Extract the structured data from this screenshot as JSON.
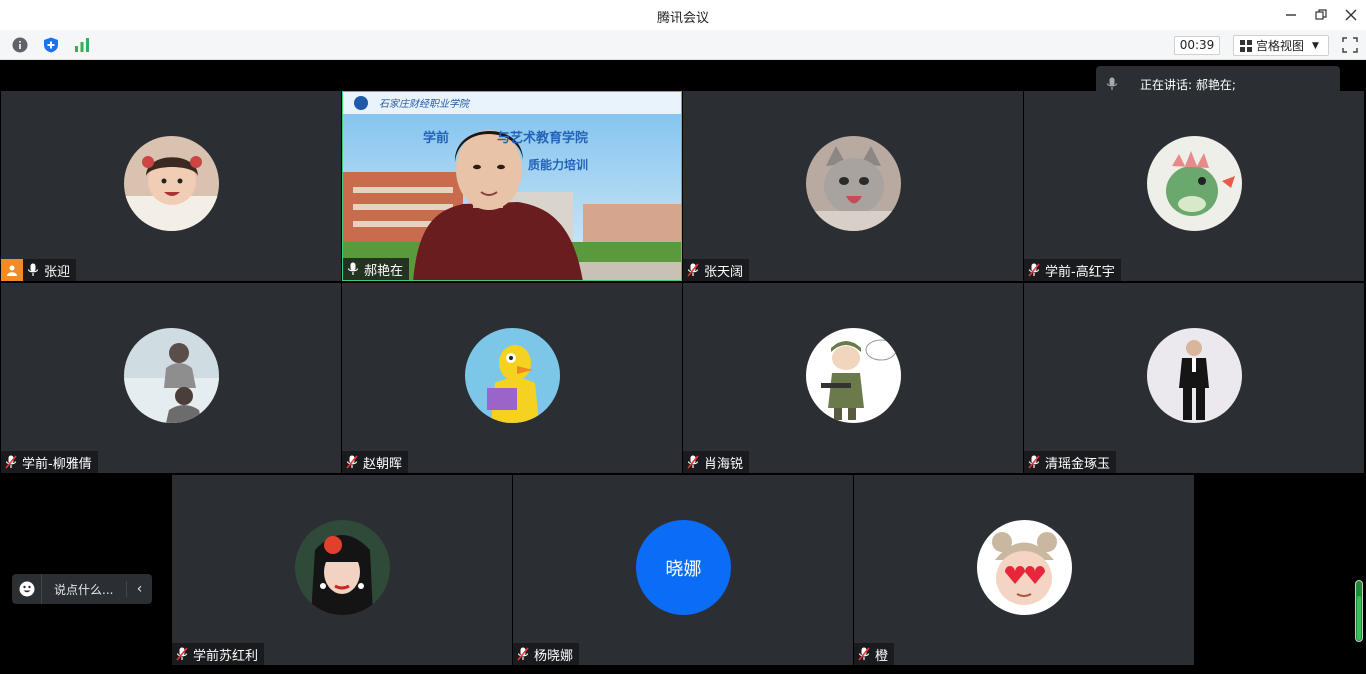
{
  "window": {
    "title": "腾讯会议"
  },
  "toolbar": {
    "timer": "00:39",
    "view_label": "宫格视图"
  },
  "speaking": {
    "text": "正在讲话: 郝艳在;"
  },
  "slide": {
    "school": "石家庄财经职业学院",
    "line1": "学前",
    "line1b": "与艺术教育学院",
    "line2": "质能力培训"
  },
  "chat": {
    "placeholder": "说点什么..."
  },
  "participants": [
    {
      "name": "张迎",
      "host": true,
      "muted": false
    },
    {
      "name": "郝艳在",
      "muted": false,
      "active": true
    },
    {
      "name": "张天阔",
      "muted": true
    },
    {
      "name": "学前-高红宇",
      "muted": true
    },
    {
      "name": "学前-柳雅倩",
      "muted": true
    },
    {
      "name": "赵朝晖",
      "muted": true
    },
    {
      "name": "肖海锐",
      "muted": true
    },
    {
      "name": "清瑶金琢玉",
      "muted": true
    },
    {
      "name": "学前苏红利",
      "muted": true
    },
    {
      "name": "杨晓娜",
      "muted": true,
      "initials": "晓娜"
    },
    {
      "name": "橙",
      "muted": true
    }
  ],
  "colors": {
    "active_border": "#3fd07a",
    "host_badge": "#f28b24",
    "initials_bg": "#0b6cf5"
  }
}
